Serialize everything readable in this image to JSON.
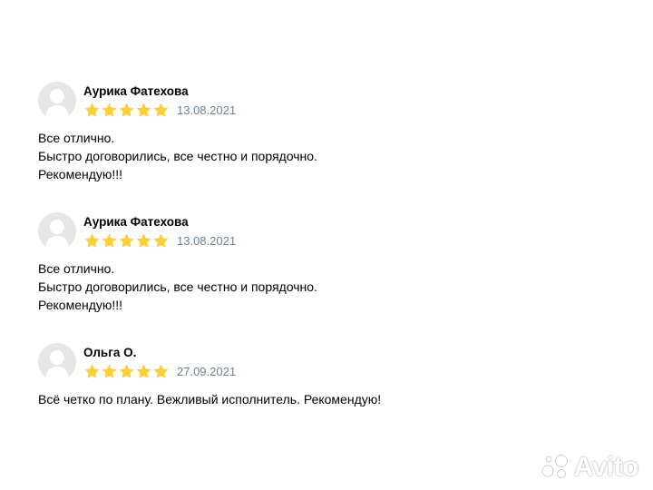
{
  "colors": {
    "star": "#fdcd3d",
    "date": "#6b7f94",
    "avatar_bg": "#e6e6e6",
    "avatar_figure": "#ffffff"
  },
  "reviews": [
    {
      "author": "Аурика Фатехова",
      "rating": 5,
      "date": "13.08.2021",
      "text": [
        "Все отлично.",
        "Быстро договорились, все честно и порядочно.",
        "Рекомендую!!!"
      ]
    },
    {
      "author": "Аурика Фатехова",
      "rating": 5,
      "date": "13.08.2021",
      "text": [
        "Все отлично.",
        "Быстро договорились, все честно и порядочно.",
        "Рекомендую!!!"
      ]
    },
    {
      "author": "Ольга О.",
      "rating": 5,
      "date": "27.09.2021",
      "text": [
        "Всё четко по плану. Вежливый исполнитель. Рекомендую!"
      ]
    }
  ],
  "watermark": {
    "icon": "avito-logo-icon",
    "text": "Avito"
  }
}
